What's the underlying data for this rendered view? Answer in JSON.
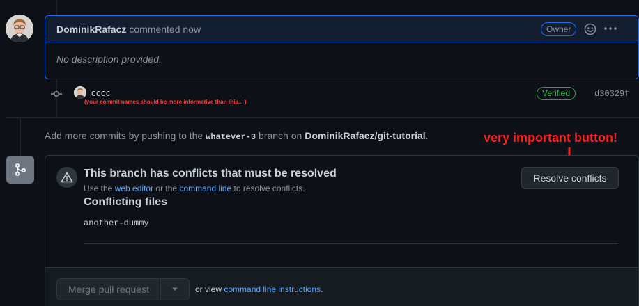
{
  "comment": {
    "author": "DominikRafacz",
    "meta": "commented now",
    "badge": "Owner",
    "body": "No description provided."
  },
  "commit": {
    "message": "cccc",
    "note": "(your commit names should be more informative than this... )",
    "verified": "Verified",
    "sha": "d30329f"
  },
  "push_info": {
    "prefix": "Add more commits by pushing to the",
    "branch": "whatever-3",
    "middle": "branch on",
    "repo": "DominikRafacz/git-tutorial",
    "suffix": "."
  },
  "annotation": {
    "text": "very important button!"
  },
  "conflicts": {
    "title": "This branch has conflicts that must be resolved",
    "help_prefix": "Use the",
    "help_link1": "web editor",
    "help_or": "or the",
    "help_link2": "command line",
    "help_suffix": "to resolve conflicts.",
    "subtitle": "Conflicting files",
    "files": [
      "another-dummy"
    ],
    "resolve_button": "Resolve conflicts"
  },
  "merge": {
    "button": "Merge pull request",
    "alt_prefix": "or view",
    "alt_link": "command line instructions",
    "alt_suffix": "."
  },
  "icons": {
    "emoji": "smiley-icon",
    "more": "kebab-icon",
    "commit": "git-commit-icon",
    "merge": "git-merge-icon",
    "warning": "alert-icon",
    "caret": "triangle-down-icon",
    "arrow": "arrow-down-icon"
  },
  "colors": {
    "accent": "#1f6feb",
    "link": "#58a6ff",
    "verified": "#3fb950",
    "annotation": "#ff1e1e"
  }
}
